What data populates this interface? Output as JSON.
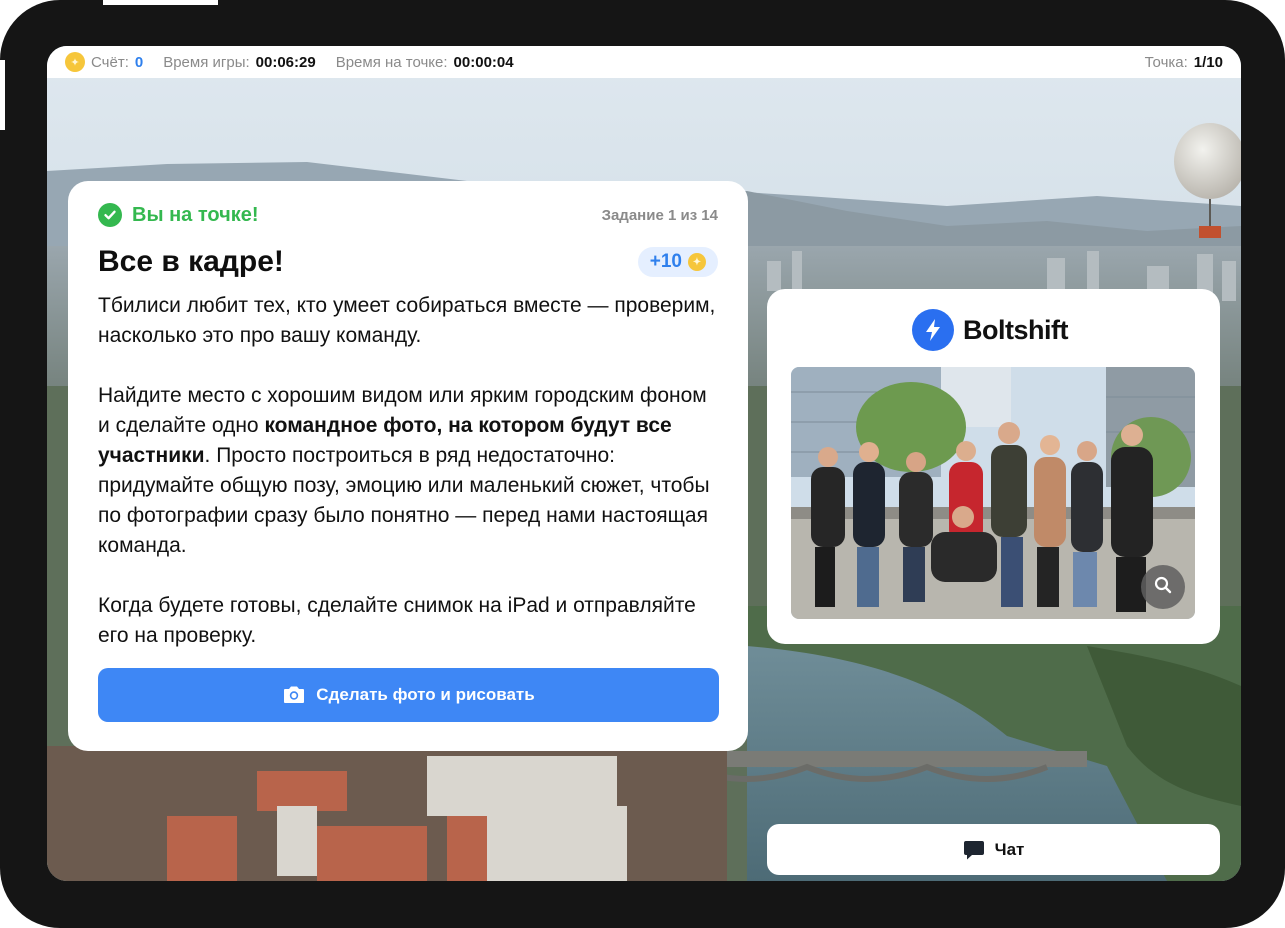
{
  "statusbar": {
    "score_label": "Счёт:",
    "score_value": "0",
    "game_time_label": "Время игры:",
    "game_time_value": "00:06:29",
    "point_time_label": "Время на точке:",
    "point_time_value": "00:00:04",
    "point_label": "Точка:",
    "point_value": "1/10"
  },
  "task": {
    "status": "Вы на точке!",
    "counter": "Задание 1 из 14",
    "title": "Все в кадре!",
    "points": "+10",
    "paragraph1": "Тбилиси любит тех, кто умеет собираться вместе — проверим, насколько это про вашу команду.",
    "paragraph2_start": "Найдите место с хорошим видом или ярким городским фоном и сделайте одно ",
    "paragraph2_bold": "командное фото, на котором будут все участники",
    "paragraph2_end": ". Просто построиться в ряд недостаточно: придумайте общую позу, эмоцию или маленький сюжет, чтобы по фотографии сразу было понятно — перед нами настоящая команда.",
    "paragraph3": "Когда будете готовы, сделайте снимок на iPad и отправляйте его на проверку.",
    "button_label": "Сделать фото и рисовать"
  },
  "sponsor": {
    "brand_name": "Boltshift"
  },
  "chat": {
    "label": "Чат"
  },
  "icons": {
    "coin": "coin-icon",
    "check": "check-circle-icon",
    "camera": "camera-icon",
    "logo": "bolt-logo-icon",
    "zoom": "magnifier-icon",
    "chat": "chat-bubble-icon"
  },
  "colors": {
    "accent": "#3e87f5",
    "success": "#34b84f",
    "coin": "#f6c63b",
    "brand": "#2a6ff0"
  }
}
